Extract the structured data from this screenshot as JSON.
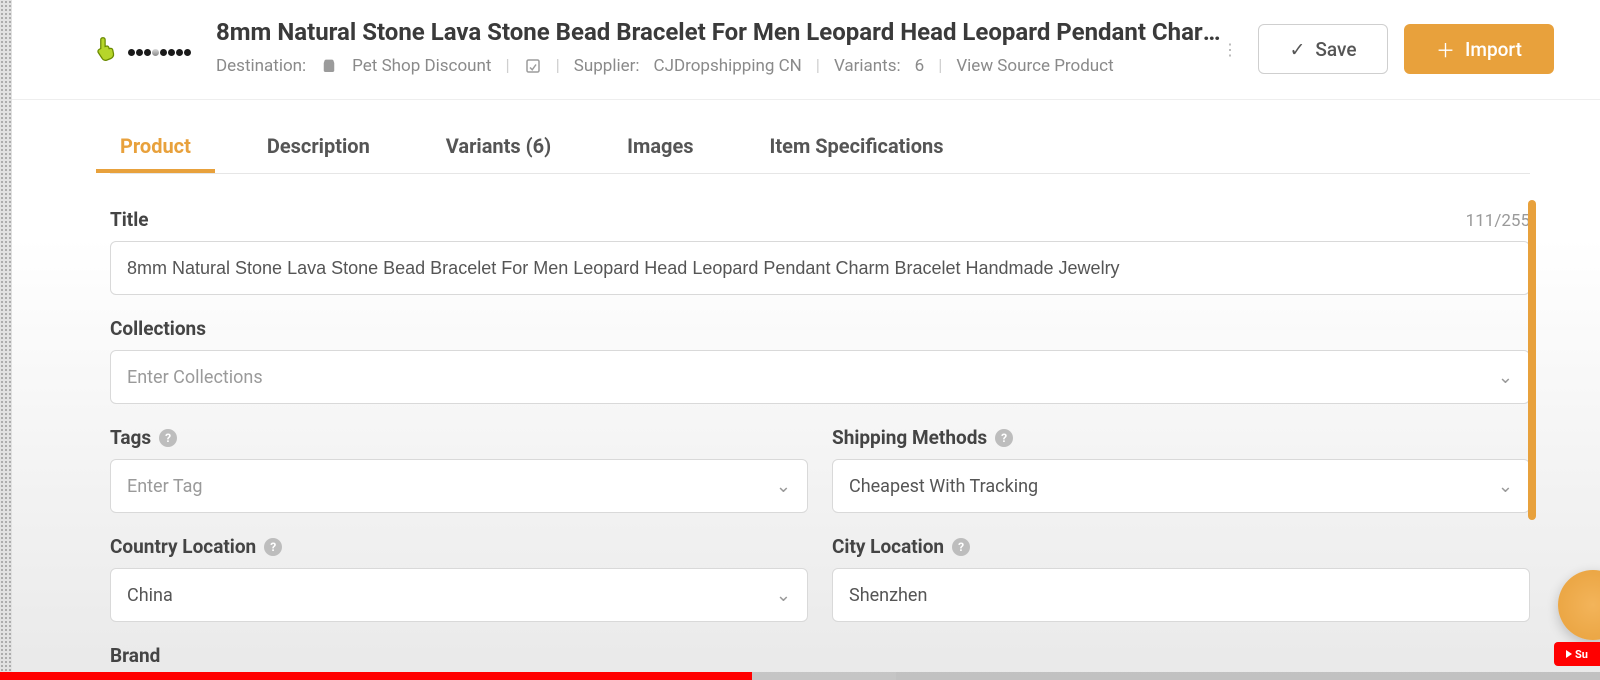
{
  "header": {
    "title": "8mm Natural Stone Lava Stone Bead Bracelet For Men Leopard Head Leopard Pendant Charm…",
    "destination_label": "Destination:",
    "destination_value": "Pet Shop Discount",
    "supplier_label": "Supplier:",
    "supplier_value": "CJDropshipping CN",
    "variants_label": "Variants:",
    "variants_value": "6",
    "view_source": "View Source Product",
    "save_label": "Save",
    "import_label": "Import"
  },
  "tabs": {
    "product": "Product",
    "description": "Description",
    "variants": "Variants (6)",
    "images": "Images",
    "specs": "Item Specifications"
  },
  "form": {
    "title_label": "Title",
    "title_counter": "111/255",
    "title_value": "8mm Natural Stone Lava Stone Bead Bracelet For Men Leopard Head Leopard Pendant Charm Bracelet Handmade Jewelry",
    "collections_label": "Collections",
    "collections_placeholder": "Enter Collections",
    "tags_label": "Tags",
    "tags_placeholder": "Enter Tag",
    "shipping_label": "Shipping Methods",
    "shipping_value": "Cheapest With Tracking",
    "country_label": "Country Location",
    "country_value": "China",
    "city_label": "City Location",
    "city_value": "Shenzhen",
    "brand_label": "Brand"
  },
  "icons": {
    "help": "?",
    "kebab": "⋮",
    "check": "✓",
    "plus": "＋",
    "chevron": "⌄",
    "shopify": "S",
    "note": "▢"
  },
  "progress": {
    "played_pct": 47,
    "buffered_pct": 56
  },
  "yt": {
    "label": "Su"
  }
}
